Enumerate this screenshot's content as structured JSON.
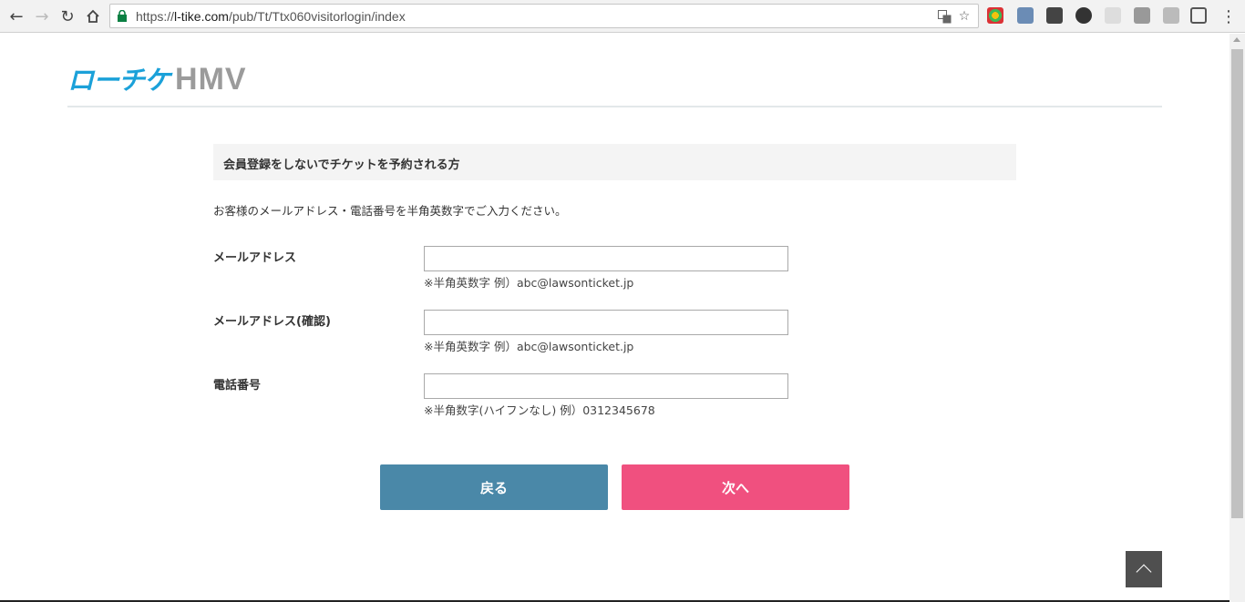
{
  "browser": {
    "url_scheme": "https://",
    "url_host": "l-tike.com",
    "url_path": "/pub/Tt/Ttx060visitorlogin/index",
    "icons": [
      "back-icon",
      "forward-icon",
      "reload-icon",
      "home-icon",
      "lock-icon",
      "translate-icon",
      "star-icon",
      "menu-icon"
    ]
  },
  "header": {
    "logo_jp": "ローチケ",
    "logo_hmv": "HMV"
  },
  "section": {
    "title": "会員登録をしないでチケットを予約される方",
    "intro": "お客様のメールアドレス・電話番号を半角英数字でご入力ください。"
  },
  "fields": [
    {
      "label": "メールアドレス",
      "value": "",
      "hint": "※半角英数字 例）abc@lawsonticket.jp"
    },
    {
      "label": "メールアドレス(確認)",
      "value": "",
      "hint": "※半角英数字 例）abc@lawsonticket.jp"
    },
    {
      "label": "電話番号",
      "value": "",
      "hint": "※半角数字(ハイフンなし) 例）0312345678"
    }
  ],
  "buttons": {
    "back_label": "戻る",
    "next_label": "次へ"
  },
  "colors": {
    "brand_blue": "#1ba1d9",
    "back_button": "#4a88a8",
    "next_button": "#f0507f"
  }
}
